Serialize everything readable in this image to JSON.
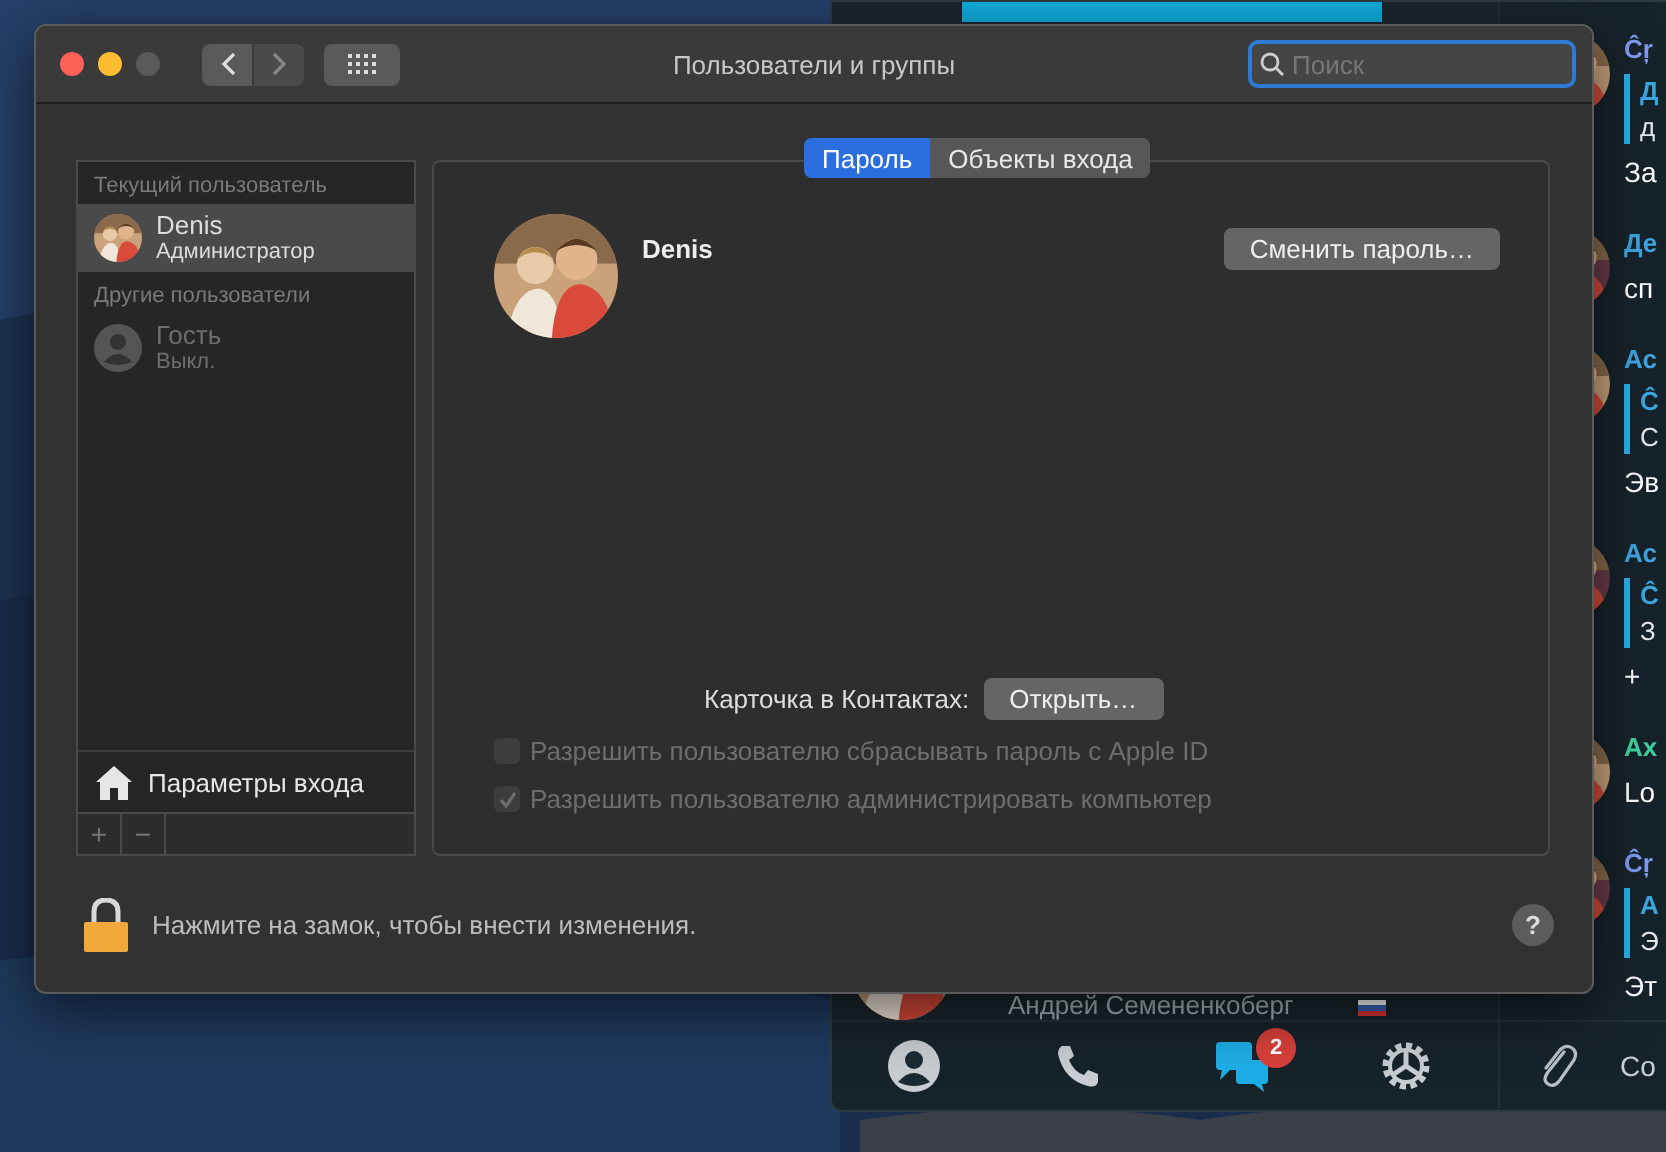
{
  "window": {
    "title": "Пользователи и группы",
    "search": {
      "placeholder": "Поиск"
    }
  },
  "sidebar": {
    "sections": [
      {
        "header": "Текущий пользователь",
        "users": [
          {
            "name": "Denis",
            "role": "Администратор",
            "selected": true,
            "disabled": false
          }
        ]
      },
      {
        "header": "Другие пользователи",
        "users": [
          {
            "name": "Гость",
            "role": "Выкл.",
            "kind": "generic",
            "selected": false,
            "disabled": true
          }
        ]
      }
    ],
    "login_options": "Параметры входа",
    "add_button": "+",
    "remove_button": "−"
  },
  "tabs": [
    {
      "label": "Пароль",
      "selected": true
    },
    {
      "label": "Объекты входа",
      "selected": false
    }
  ],
  "user": {
    "name": "Denis",
    "change_password_button": "Сменить пароль…"
  },
  "contacts": {
    "label": "Карточка в Контактах:",
    "button": "Открыть…"
  },
  "options": [
    {
      "label": "Разрешить пользователю сбрасывать пароль с Apple ID",
      "checked": false,
      "disabled": true
    },
    {
      "label": "Разрешить пользователю администрировать компьютер",
      "checked": true,
      "disabled": true
    }
  ],
  "lock_message": "Нажмите на замок, чтобы внести изменения.",
  "help_button": "?",
  "chat_app": {
    "messages": [
      {
        "sender": "Ĉŗ",
        "color": "#7d9cf2",
        "quote": {
          "sender": "Д",
          "text": "д"
        },
        "text": "За"
      },
      {
        "sender": "Де",
        "color": "#3ea6e3",
        "text": "сп"
      },
      {
        "sender": "Ас",
        "color": "#3ea6e3",
        "quote": {
          "sender": "Ĉ",
          "text": "С"
        },
        "text": "Эв"
      },
      {
        "sender": "Ас",
        "color": "#3ea6e3",
        "quote": {
          "sender": "Ĉ",
          "text": "З"
        },
        "text": "+"
      },
      {
        "sender": "Ах",
        "color": "#3fd39e",
        "text": "Lo"
      },
      {
        "sender": "Ĉŗ",
        "color": "#7d9cf2",
        "quote": {
          "sender": "А",
          "text": "Э"
        },
        "text": "Эт"
      }
    ],
    "contact": "Андрей Семененкоберг",
    "nav": [
      {
        "kind": "contacts",
        "selected": false
      },
      {
        "kind": "calls",
        "selected": false
      },
      {
        "kind": "chats",
        "selected": true,
        "badge": "2"
      },
      {
        "kind": "settings",
        "selected": false
      }
    ],
    "compose_text": "Со"
  }
}
